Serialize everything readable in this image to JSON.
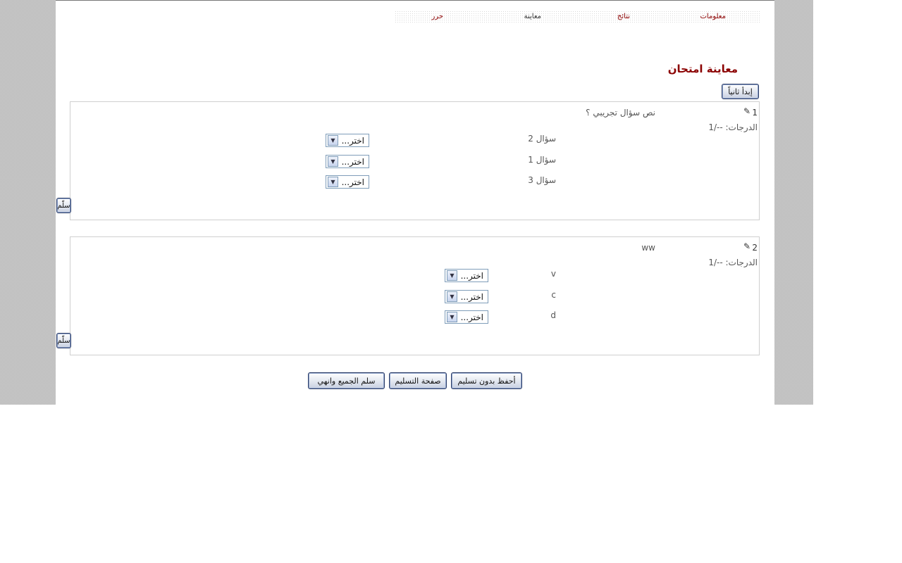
{
  "tabs": [
    "معلومات",
    "نتائج",
    "معاينة",
    "حرر"
  ],
  "page_title": "معاينة امتحان",
  "restart_label": "إبدأ ثانياً",
  "questions": [
    {
      "number": "1",
      "text": "نص سؤال تجريبي ؟",
      "grades": "الدرجات: --/1",
      "rows": [
        {
          "label": "سؤال 2",
          "selected": "اختر..."
        },
        {
          "label": "سؤال 1",
          "selected": "اختر..."
        },
        {
          "label": "سؤال 3",
          "selected": "اختر..."
        }
      ],
      "submit_label": "سلّم"
    },
    {
      "number": "2",
      "text": "ww",
      "grades": "الدرجات: --/1",
      "rows": [
        {
          "label": "v",
          "selected": "اختر..."
        },
        {
          "label": "c",
          "selected": "اختر..."
        },
        {
          "label": "d",
          "selected": "اختر..."
        }
      ],
      "submit_label": "سلّم"
    }
  ],
  "footer_buttons": {
    "save_without_submit": "أحفظ بدون تسليم",
    "submit_page": "صفحة التسليم",
    "submit_all_finish": "سلم الجميع وانهي"
  },
  "icons": {
    "edit": "pencil-icon",
    "dropdown": "chevron-down-icon"
  }
}
